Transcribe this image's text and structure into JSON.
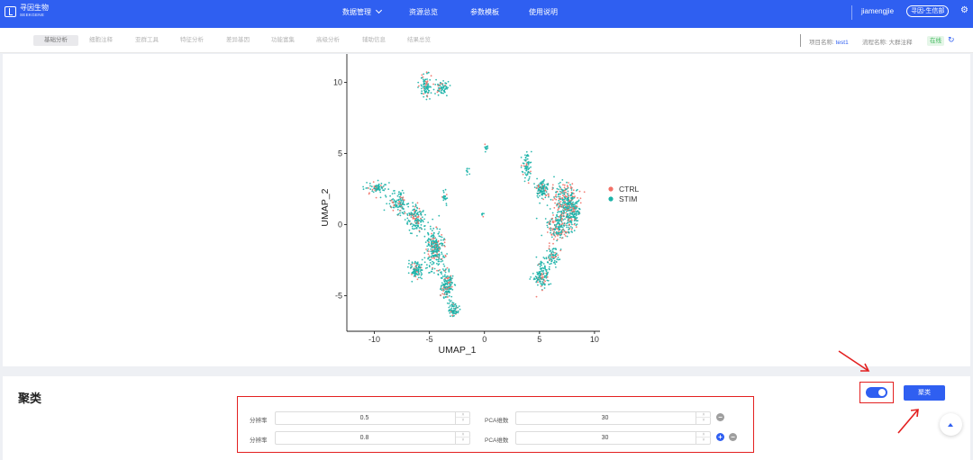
{
  "header": {
    "logo_cn": "寻因生物",
    "logo_en": "SEEKGENE",
    "nav": [
      "数据管理",
      "资源总览",
      "参数模板",
      "使用说明"
    ],
    "user": "jiamengjie",
    "dept": "寻因-生信部"
  },
  "subnav": {
    "tabs": [
      "基础分析",
      "细胞注释",
      "亚群工具",
      "特征分析",
      "差异基因",
      "功能富集",
      "高级分析",
      "辅助信息",
      "结果总览"
    ],
    "project_label": "项目名称: ",
    "project_value": "test1",
    "flow_label": "流程名称: 大群注释",
    "status": "在线"
  },
  "chart_data": {
    "type": "scatter",
    "xlabel": "UMAP_1",
    "ylabel": "UMAP_2",
    "xlim": [
      -12.5,
      10.5
    ],
    "ylim": [
      -7.5,
      12
    ],
    "xticks": [
      -10,
      -5,
      0,
      5,
      10
    ],
    "yticks": [
      -5,
      0,
      5,
      10
    ],
    "grid": false,
    "legend": "right",
    "series": [
      {
        "name": "CTRL",
        "color": "#f27066"
      },
      {
        "name": "STIM",
        "color": "#1bb3a8"
      }
    ],
    "clusters": [
      {
        "x": -5.3,
        "y": 9.7
      },
      {
        "x": -3.8,
        "y": 9.6
      },
      {
        "x": -9.8,
        "y": 2.6
      },
      {
        "x": -7.8,
        "y": 1.5
      },
      {
        "x": -6.2,
        "y": 0.4
      },
      {
        "x": -4.5,
        "y": -1.7
      },
      {
        "x": -6.2,
        "y": -3.2
      },
      {
        "x": -3.4,
        "y": -4.2
      },
      {
        "x": -2.8,
        "y": -6.0
      },
      {
        "x": -3.6,
        "y": 2.0
      },
      {
        "x": 0.2,
        "y": 5.4
      },
      {
        "x": 3.8,
        "y": 4.2
      },
      {
        "x": 5.3,
        "y": 2.5
      },
      {
        "x": 7.4,
        "y": 1.7
      },
      {
        "x": 6.7,
        "y": -0.2
      },
      {
        "x": 8.0,
        "y": 0.8
      },
      {
        "x": 5.2,
        "y": -3.6
      },
      {
        "x": 6.2,
        "y": -2.2
      },
      {
        "x": -1.5,
        "y": 3.8
      },
      {
        "x": -0.2,
        "y": 0.7
      }
    ]
  },
  "clustering": {
    "title": "聚类",
    "run_label": "聚类",
    "rows": [
      {
        "res_label": "分辨率",
        "resolution": "0.5",
        "pca_label": "PCA维数",
        "pca": "30",
        "minus": "−"
      },
      {
        "res_label": "分辨率",
        "resolution": "0.8",
        "pca_label": "PCA维数",
        "pca": "30",
        "plus": "+",
        "minus": "−"
      }
    ]
  },
  "colors": {
    "accent": "#2f5ff1",
    "highlight": "#e32020",
    "online": "#3fb85c"
  }
}
